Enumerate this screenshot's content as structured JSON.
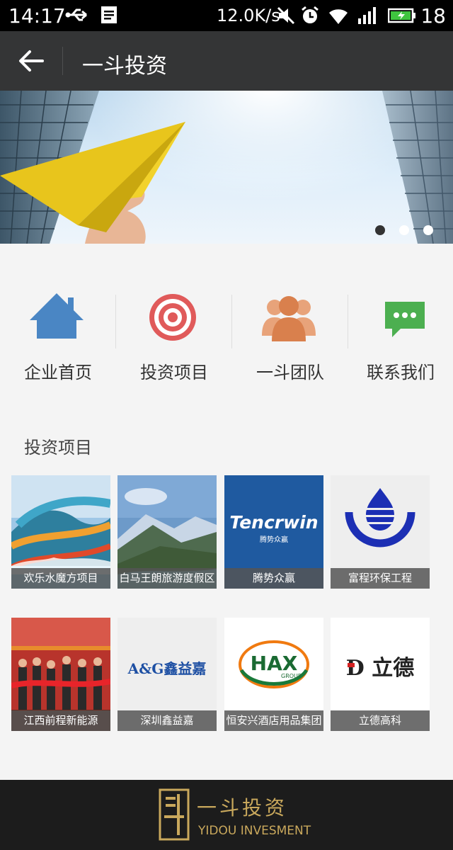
{
  "status_bar": {
    "time": "14:17",
    "net_speed": "12.0K/s",
    "battery_percent": "18"
  },
  "header": {
    "title": "一斗投资"
  },
  "banner": {
    "dot_count": 3,
    "active_dot": 1
  },
  "quick_nav": [
    {
      "label": "企业首页",
      "icon": "house-icon",
      "color": "#4a86c4"
    },
    {
      "label": "投资项目",
      "icon": "target-icon",
      "color": "#e05a5a"
    },
    {
      "label": "一斗团队",
      "icon": "team-icon",
      "color": "#e08a5a"
    },
    {
      "label": "联系我们",
      "icon": "chat-icon",
      "color": "#4caf50"
    }
  ],
  "section": {
    "title": "投资项目"
  },
  "projects": [
    {
      "name": "欢乐水魔方项目"
    },
    {
      "name": "白马王朗旅游度假区"
    },
    {
      "name": "腾势众赢",
      "logo_text": "Tencrwin",
      "logo_sub": "腾势众赢"
    },
    {
      "name": "富程环保工程"
    },
    {
      "name": "江西前程新能源"
    },
    {
      "name": "深圳鑫益嘉",
      "logo_text": "A&G鑫益嘉"
    },
    {
      "name": "恒安兴酒店用品集团",
      "logo_text": "HAX",
      "logo_sub": "GROUP"
    },
    {
      "name": "立德高科",
      "logo_text": "D 立德"
    }
  ],
  "footer": {
    "brand_cn": "一斗投资",
    "brand_en": "YIDOU INVESMENT"
  }
}
